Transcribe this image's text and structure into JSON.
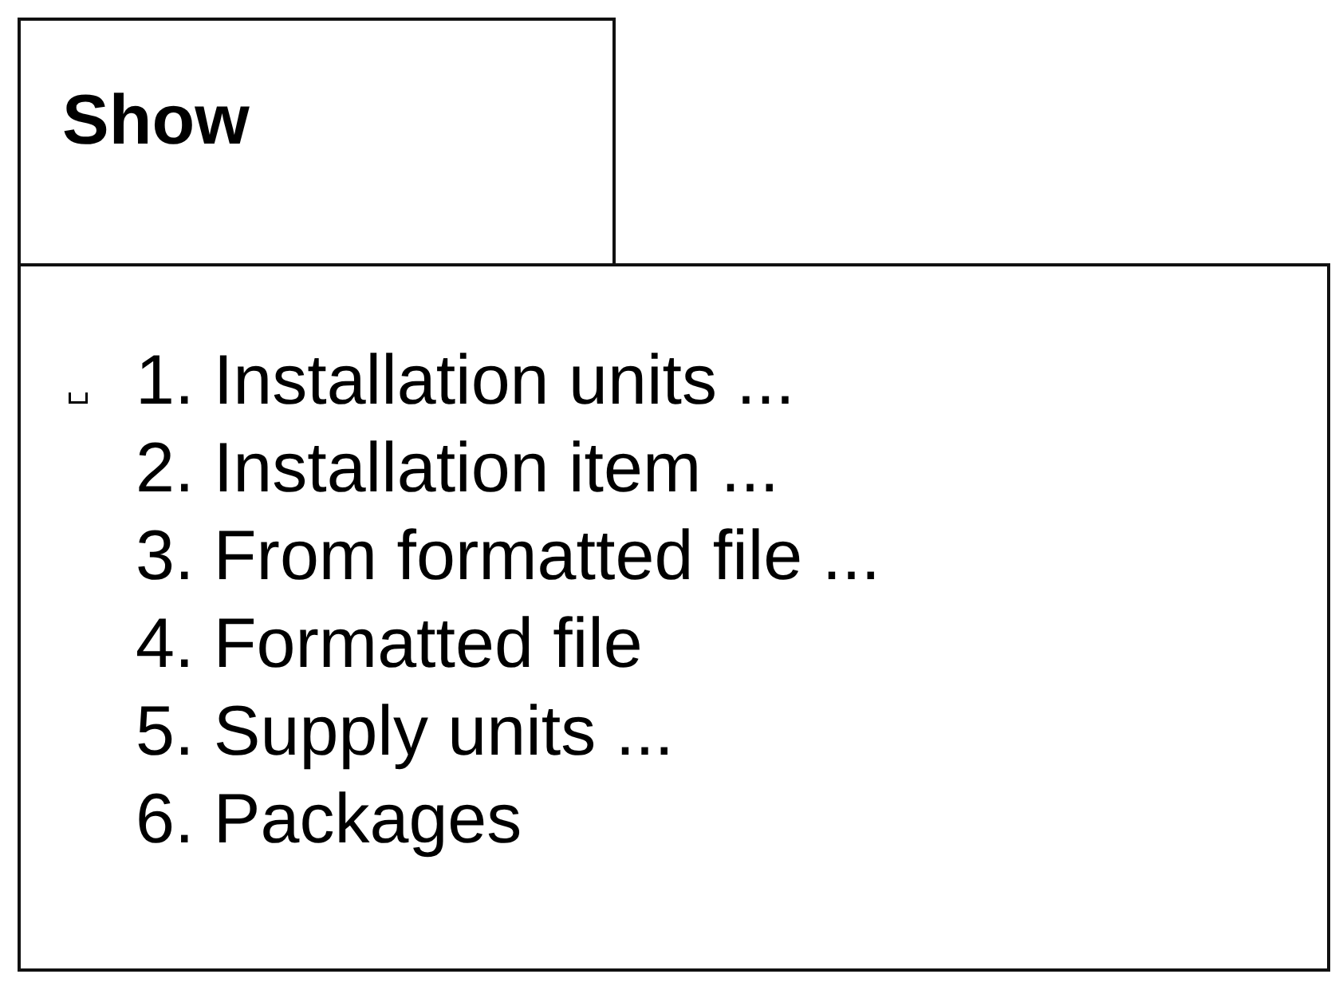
{
  "header": {
    "title": "Show"
  },
  "menu": {
    "items": [
      {
        "label": "1. Installation units ...",
        "selected": true
      },
      {
        "label": "2. Installation item ...",
        "selected": false
      },
      {
        "label": "3. From formatted file ...",
        "selected": false
      },
      {
        "label": "4. Formatted file",
        "selected": false
      },
      {
        "label": "5. Supply units ...",
        "selected": false
      },
      {
        "label": "6. Packages",
        "selected": false
      }
    ]
  }
}
